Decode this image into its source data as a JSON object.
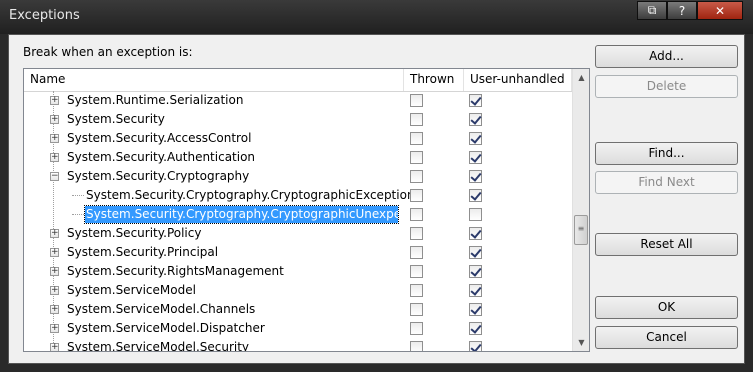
{
  "window": {
    "title": "Exceptions"
  },
  "caption_buttons": {
    "restore": "⧉",
    "help": "?",
    "close": "✕"
  },
  "dialog": {
    "caption": "Break when an exception is:"
  },
  "columns": {
    "name": "Name",
    "thrown": "Thrown",
    "user_unhandled": "User-unhandled"
  },
  "rows": [
    {
      "label": "System.Runtime.Serialization",
      "expander": "+",
      "thrown": false,
      "user_unhandled": true,
      "selected": false
    },
    {
      "label": "System.Security",
      "expander": "+",
      "thrown": false,
      "user_unhandled": true,
      "selected": false
    },
    {
      "label": "System.Security.AccessControl",
      "expander": "+",
      "thrown": false,
      "user_unhandled": true,
      "selected": false
    },
    {
      "label": "System.Security.Authentication",
      "expander": "+",
      "thrown": false,
      "user_unhandled": true,
      "selected": false
    },
    {
      "label": "System.Security.Cryptography",
      "expander": "−",
      "thrown": false,
      "user_unhandled": true,
      "selected": false
    },
    {
      "label": "System.Security.Cryptography.CryptographicException",
      "expander": "",
      "thrown": false,
      "user_unhandled": true,
      "selected": false
    },
    {
      "label": "System.Security.Cryptography.CryptographicUnexpectedO",
      "expander": "",
      "thrown": false,
      "user_unhandled": false,
      "selected": true
    },
    {
      "label": "System.Security.Policy",
      "expander": "+",
      "thrown": false,
      "user_unhandled": true,
      "selected": false
    },
    {
      "label": "System.Security.Principal",
      "expander": "+",
      "thrown": false,
      "user_unhandled": true,
      "selected": false
    },
    {
      "label": "System.Security.RightsManagement",
      "expander": "+",
      "thrown": false,
      "user_unhandled": true,
      "selected": false
    },
    {
      "label": "System.ServiceModel",
      "expander": "+",
      "thrown": false,
      "user_unhandled": true,
      "selected": false
    },
    {
      "label": "System.ServiceModel.Channels",
      "expander": "+",
      "thrown": false,
      "user_unhandled": true,
      "selected": false
    },
    {
      "label": "System.ServiceModel.Dispatcher",
      "expander": "+",
      "thrown": false,
      "user_unhandled": true,
      "selected": false
    },
    {
      "label": "System.ServiceModel.Security",
      "expander": "+",
      "thrown": false,
      "user_unhandled": true,
      "selected": false
    }
  ],
  "scrollbar": {
    "up": "▲",
    "down": "▼",
    "grip": "≡"
  },
  "buttons": {
    "add": "Add...",
    "delete": "Delete",
    "find": "Find...",
    "find_next": "Find Next",
    "reset_all": "Reset All",
    "ok": "OK",
    "cancel": "Cancel"
  }
}
